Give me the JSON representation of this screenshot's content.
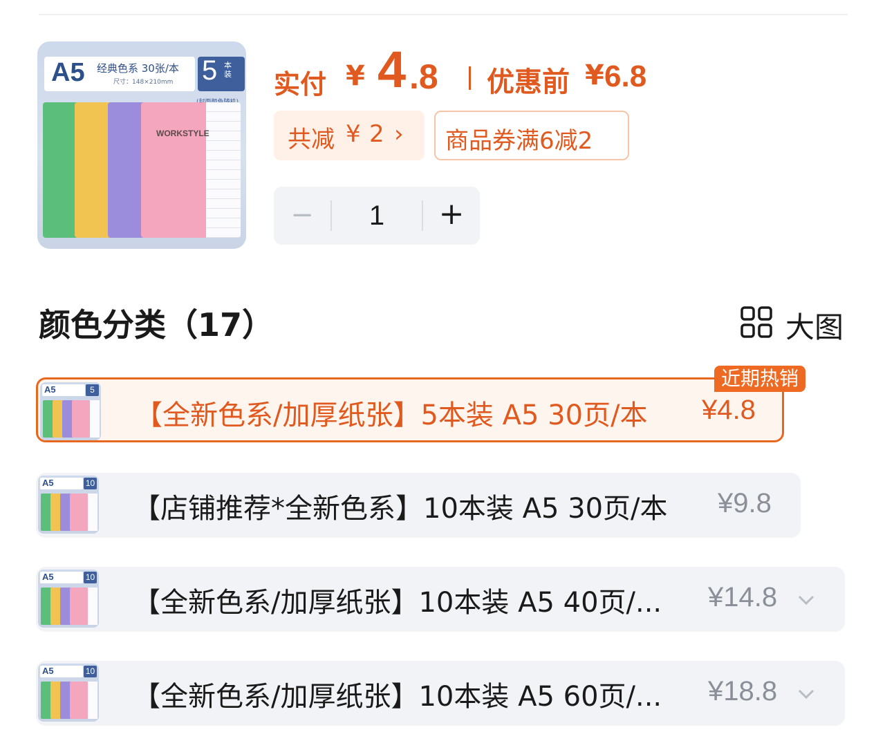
{
  "product": {
    "thumbnail": {
      "size_tag": "A5",
      "series": "经典色系 30张/本",
      "dimensions": "尺寸：148×210mm",
      "pack_count": "5",
      "pack_unit": "本装",
      "pack_note": "(封面颜色随机)",
      "cover_text": "WORKSTYLE"
    }
  },
  "price": {
    "paid_label": "实付",
    "yen": "¥",
    "paid_int": "4",
    "paid_dec": ".8",
    "original_label": "优惠前",
    "original_yen": "¥",
    "original_value": "6.8"
  },
  "discount": {
    "total_label": "共减",
    "total_yen": "¥",
    "total_value": "2",
    "chevron": "›",
    "coupon_text": "商品券满6减2"
  },
  "quantity": {
    "minus": "−",
    "value": "1",
    "plus": "+"
  },
  "section": {
    "title": "颜色分类（17）",
    "view_label": "大图",
    "view_icon": "grid-icon"
  },
  "options": [
    {
      "name": "【全新色系/加厚纸张】5本装 A5 30页/本",
      "price": "¥4.8",
      "badge": "近期热销",
      "pack": "5",
      "selected": true
    },
    {
      "name": "【店铺推荐*全新色系】10本装 A5 30页/本",
      "price": "¥9.8",
      "pack": "10",
      "selected": false
    },
    {
      "name": "【全新色系/加厚纸张】10本装 A5 40页/...",
      "price": "¥14.8",
      "pack": "10",
      "selected": false
    },
    {
      "name": "【全新色系/加厚纸张】10本装 A5 60页/...",
      "price": "¥18.8",
      "pack": "10",
      "selected": false
    }
  ],
  "colors": {
    "accent": "#e0591f",
    "badge": "#ee6a22",
    "row_bg": "#f2f3f6"
  }
}
